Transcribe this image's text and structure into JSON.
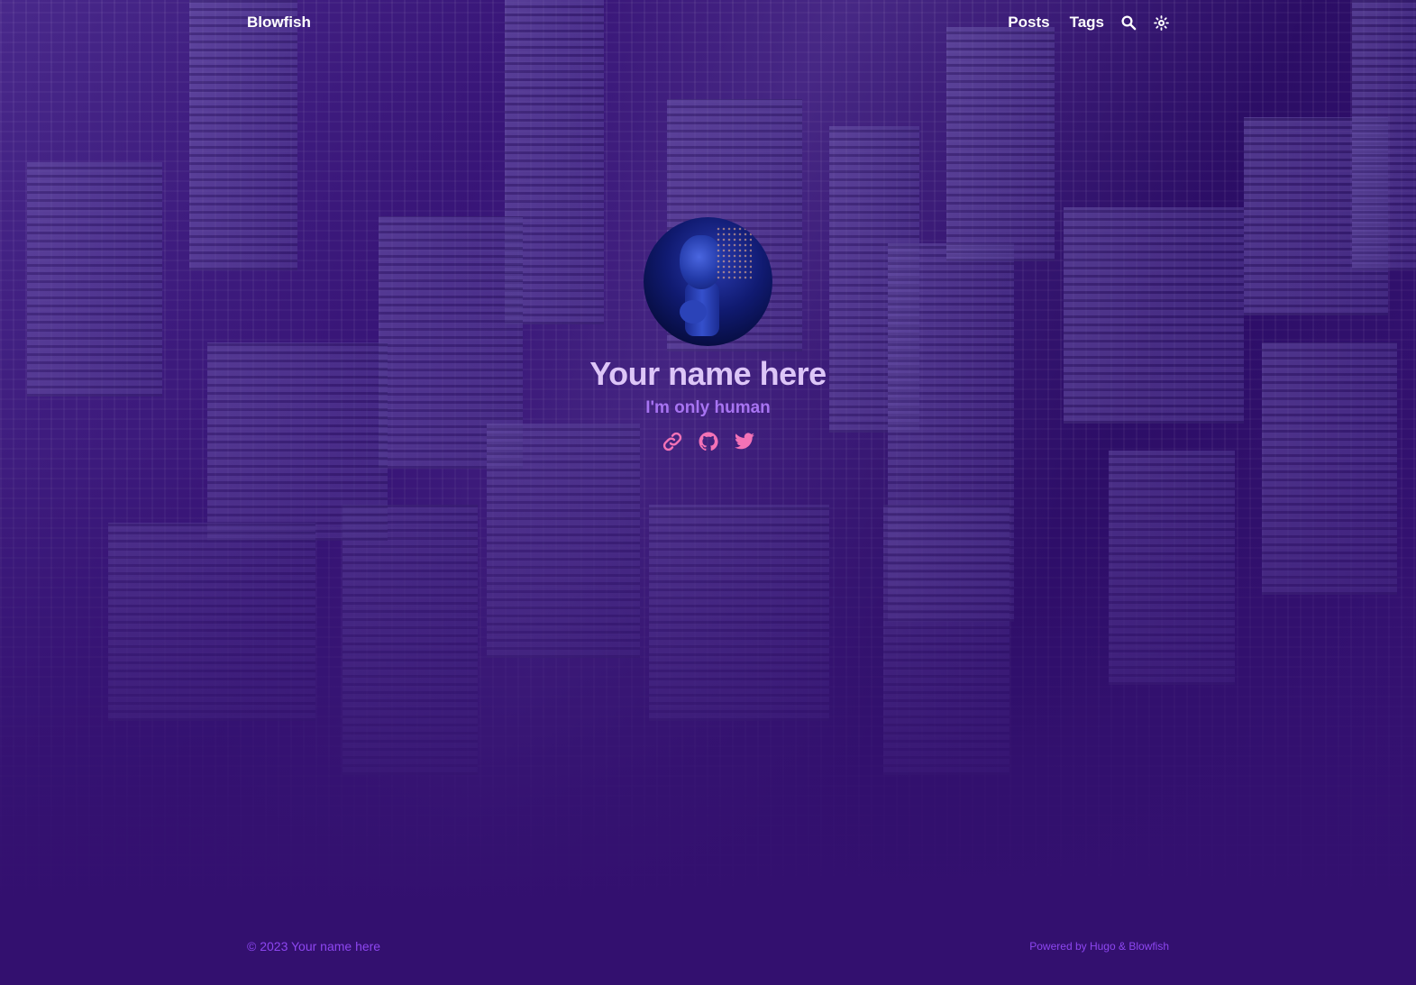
{
  "header": {
    "brand": "Blowfish",
    "nav": [
      {
        "label": "Posts"
      },
      {
        "label": "Tags"
      }
    ],
    "icons": [
      "search-icon",
      "theme-toggle-icon"
    ]
  },
  "profile": {
    "name": "Your name here",
    "tagline": "I'm only human",
    "avatar_alt": "profile-photo",
    "socials": [
      "link-icon",
      "github-icon",
      "twitter-icon"
    ]
  },
  "footer": {
    "copyright": "© 2023 Your name here",
    "powered_prefix": "Powered by ",
    "powered_hugo": "Hugo",
    "powered_sep": " & ",
    "powered_blowfish": "Blowfish"
  },
  "colors": {
    "background": "#33106f",
    "name": "#ddc6f7",
    "tagline": "#a874f2",
    "social_icons": "#f472b6",
    "footer_text": "#8d46f0"
  }
}
